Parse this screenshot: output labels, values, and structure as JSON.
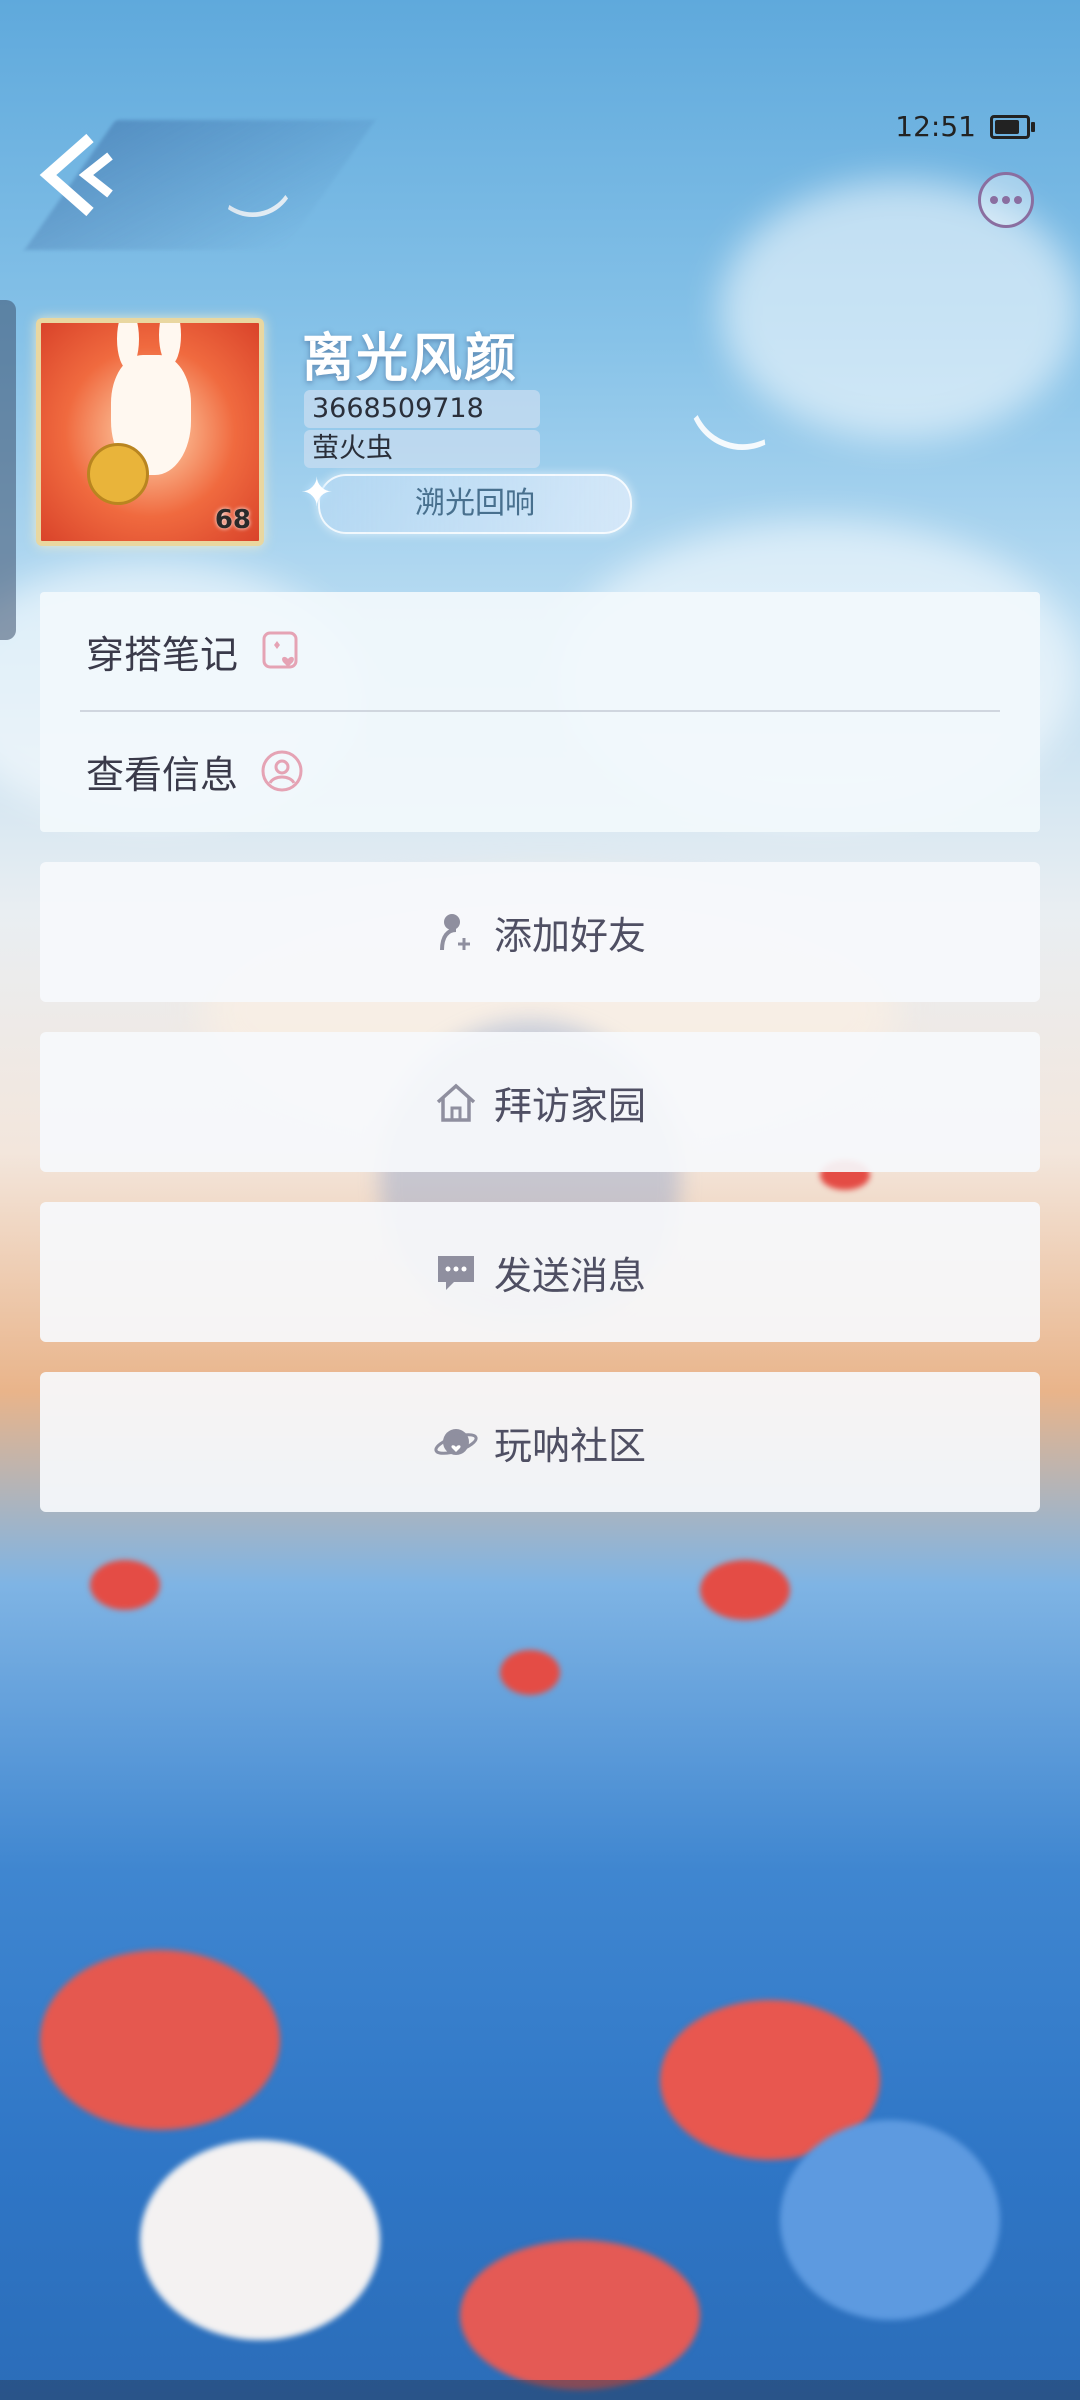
{
  "status_bar": {
    "time": "12:51",
    "battery_level": 0.8
  },
  "profile": {
    "name": "离光风颜",
    "uid": "3668509718",
    "title": "萤火虫",
    "badge": "溯光回响",
    "level": "68"
  },
  "menu": {
    "items": [
      {
        "label": "穿搭笔记",
        "icon": "outfit-notes-icon"
      },
      {
        "label": "查看信息",
        "icon": "profile-info-icon"
      }
    ]
  },
  "actions": [
    {
      "label": "添加好友",
      "icon": "add-friend-icon"
    },
    {
      "label": "拜访家园",
      "icon": "home-icon"
    },
    {
      "label": "发送消息",
      "icon": "message-icon"
    },
    {
      "label": "玩呐社区",
      "icon": "community-planet-icon"
    }
  ],
  "colors": {
    "accent_purple": "#8a6ea0",
    "icon_pink": "#e5a3b4",
    "text_dark": "#3a3a4a"
  }
}
